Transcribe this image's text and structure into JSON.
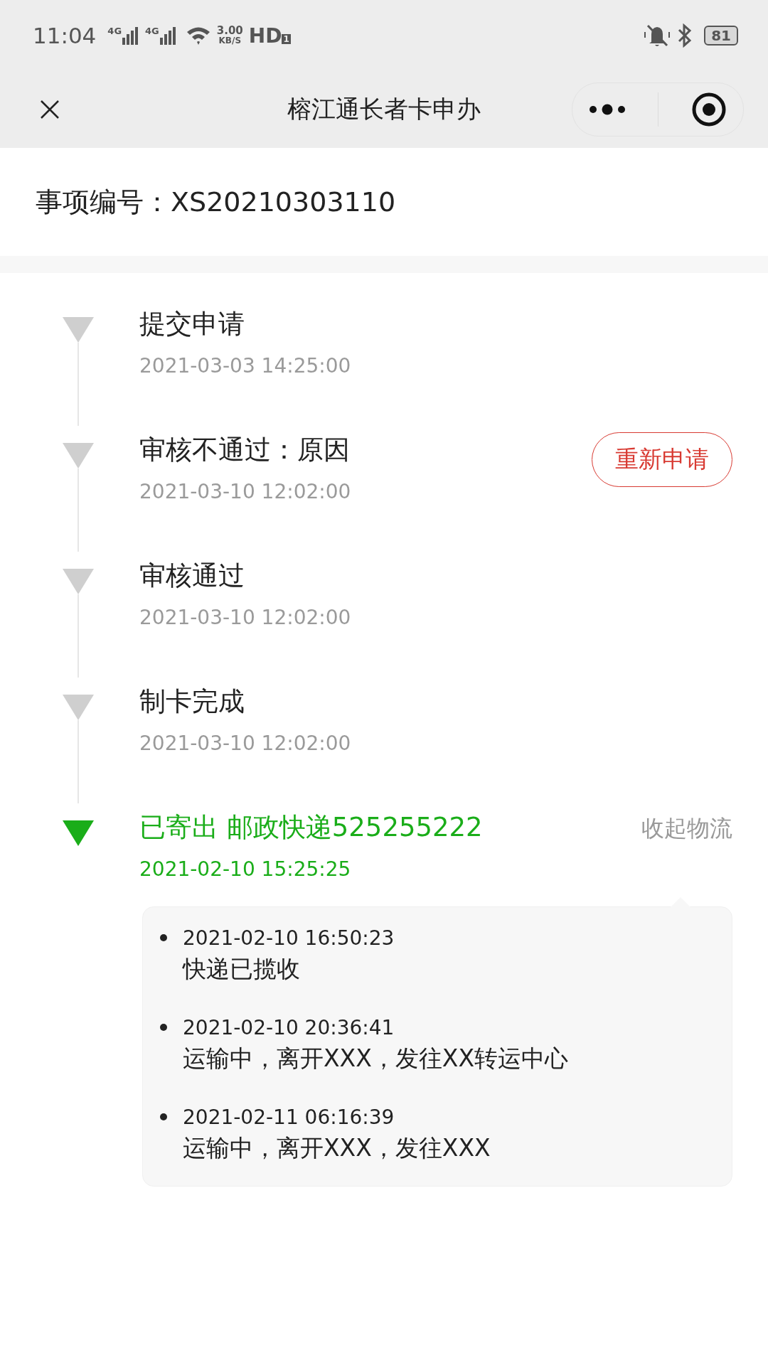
{
  "status_bar": {
    "time": "11:04",
    "network_labels": [
      "4G",
      "4G"
    ],
    "speed_value": "3.00",
    "speed_unit": "KB/S",
    "hd": "HD",
    "hd_index": "1",
    "battery": "81"
  },
  "nav_bar": {
    "title": "榕江通长者卡申办"
  },
  "item_number": {
    "label": "事项编号：",
    "value": "XS20210303110"
  },
  "timeline": [
    {
      "title": "提交申请",
      "time": "2021-03-03 14:25:00",
      "current": false
    },
    {
      "title": "审核不通过：原因",
      "time": "2021-03-10 12:02:00",
      "current": false,
      "action": "重新申请"
    },
    {
      "title": "审核通过",
      "time": "2021-03-10 12:02:00",
      "current": false
    },
    {
      "title": "制卡完成",
      "time": "2021-03-10 12:02:00",
      "current": false
    },
    {
      "title": "已寄出 邮政快递525255222",
      "time": "2021-02-10 15:25:25",
      "current": true,
      "toggle": "收起物流",
      "logistics": [
        {
          "time": "2021-02-10 16:50:23",
          "text": "快递已揽收"
        },
        {
          "time": "2021-02-10 20:36:41",
          "text": "运输中，离开XXX，发往XX转运中心"
        },
        {
          "time": "2021-02-11 06:16:39",
          "text": "运输中，离开XXX，发往XXX"
        }
      ]
    }
  ]
}
